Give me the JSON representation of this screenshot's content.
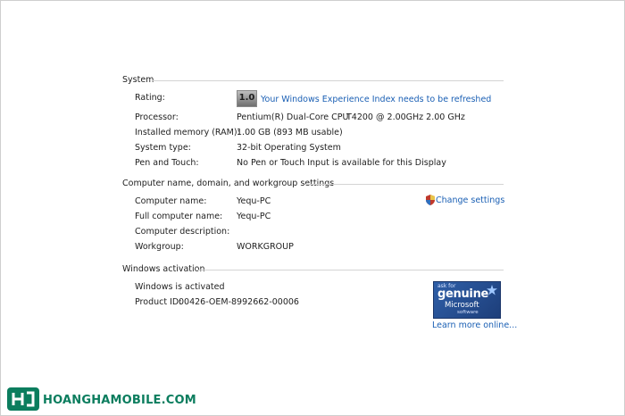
{
  "system": {
    "title": "System",
    "rating": {
      "label": "Rating:",
      "score": "1.0",
      "link": "Your Windows Experience Index needs to be refreshed"
    },
    "processor": {
      "label": "Processor:",
      "value": "Pentium(R) Dual-Core CPU",
      "model": "T4200  @ 2.00GHz  2.00 GHz"
    },
    "memory": {
      "label": "Installed memory (RAM):",
      "value": "1.00 GB (893 MB usable)"
    },
    "system_type": {
      "label": "System type:",
      "value": "32-bit Operating System"
    },
    "pen_touch": {
      "label": "Pen and Touch:",
      "value": "No Pen or Touch Input is available for this Display"
    }
  },
  "computer": {
    "title": "Computer name, domain, and workgroup settings",
    "change_settings": "Change settings",
    "computer_name": {
      "label": "Computer name:",
      "value": "Yequ-PC"
    },
    "full_name": {
      "label": "Full computer name:",
      "value": "Yequ-PC"
    },
    "description": {
      "label": "Computer description:",
      "value": ""
    },
    "workgroup": {
      "label": "Workgroup:",
      "value": "WORKGROUP"
    }
  },
  "activation": {
    "title": "Windows activation",
    "status": "Windows is activated",
    "product_id_label": "Product ID:",
    "product_id": "00426-OEM-8992662-00006",
    "learn_more": "Learn more online...",
    "genuine": {
      "ask": "ask for",
      "big": "genuine",
      "ms": "Microsoft",
      "sw": "software"
    }
  },
  "watermark": {
    "text": "HOANGHAMOBILE.COM",
    "color": "#0b7d5e"
  }
}
